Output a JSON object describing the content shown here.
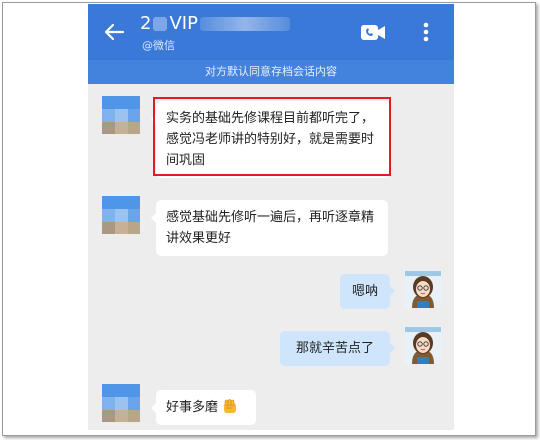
{
  "header": {
    "name_visible_prefix": "2",
    "name_visible_suffix": "VIP",
    "subtitle": "@微信"
  },
  "notice": "对方默认同意存档会话内容",
  "messages": [
    {
      "side": "left",
      "text": "实务的基础先修课程目前都听完了，感觉冯老师讲的特别好，就是需要时间巩固",
      "highlighted": true
    },
    {
      "side": "left",
      "text": "感觉基础先修听一遍后，再听逐章精讲效果更好"
    },
    {
      "side": "right",
      "text": "嗯呐"
    },
    {
      "side": "right",
      "text": "那就辛苦点了"
    },
    {
      "side": "left",
      "text": "好事多磨",
      "emoji": "fist-emoji"
    }
  ],
  "colors": {
    "header": "#3a79d8",
    "notice_bar": "#4483dd",
    "chat_bg": "#ededed",
    "bubble_right": "#cfe5fb",
    "highlight": "#e11b22"
  },
  "icons": [
    "back-arrow-icon",
    "video-call-icon",
    "more-vertical-icon"
  ]
}
